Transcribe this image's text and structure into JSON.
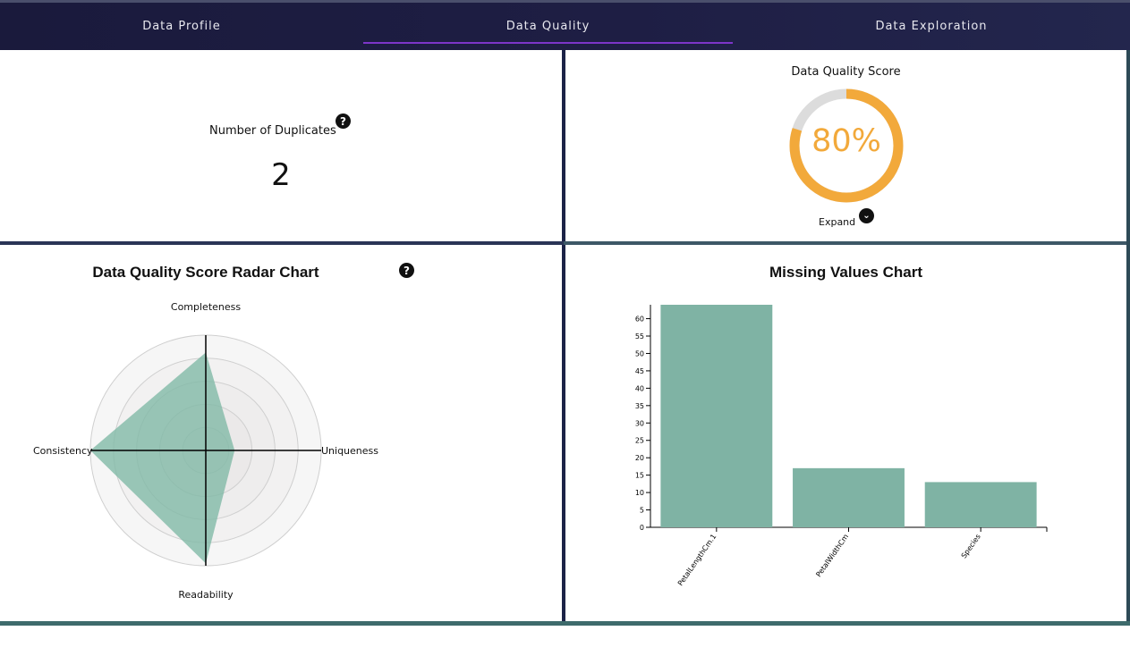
{
  "nav": {
    "tabs": [
      {
        "label": "Data Profile"
      },
      {
        "label": "Data Quality"
      },
      {
        "label": "Data Exploration"
      }
    ],
    "active_tab": "Data Quality"
  },
  "duplicates": {
    "label": "Number of Duplicates",
    "value": "2"
  },
  "quality_score": {
    "title": "Data Quality Score",
    "value_text": "80%",
    "value": 0.8,
    "expand_label": "Expand",
    "colors": {
      "fill": "#f2a93b",
      "track": "#dcdcdc"
    }
  },
  "radar": {
    "title": "Data Quality Score Radar Chart",
    "axes": [
      "Completeness",
      "Uniqueness",
      "Readability",
      "Consistency"
    ],
    "values": [
      0.85,
      0.25,
      0.98,
      1.0
    ],
    "colors": {
      "fill": "#7fb8a5"
    }
  },
  "missing": {
    "title": "Missing Values Chart",
    "bar_color": "#7fb3a4"
  },
  "chart_data": {
    "type": "bar",
    "title": "Missing Values Chart",
    "categories": [
      "PetalLengthCm.1",
      "PetalWidthCm",
      "Species"
    ],
    "values": [
      64,
      17,
      13
    ],
    "ylim": [
      0,
      64
    ],
    "yticks": [
      0,
      5,
      10,
      15,
      20,
      25,
      30,
      35,
      40,
      45,
      50,
      55,
      60
    ],
    "ytick_labels": [
      "0",
      "5",
      "10",
      "15",
      "20",
      "25",
      "30",
      "35",
      "40",
      "45",
      "50",
      "55",
      "60"
    ],
    "xlabel": "",
    "ylabel": ""
  }
}
